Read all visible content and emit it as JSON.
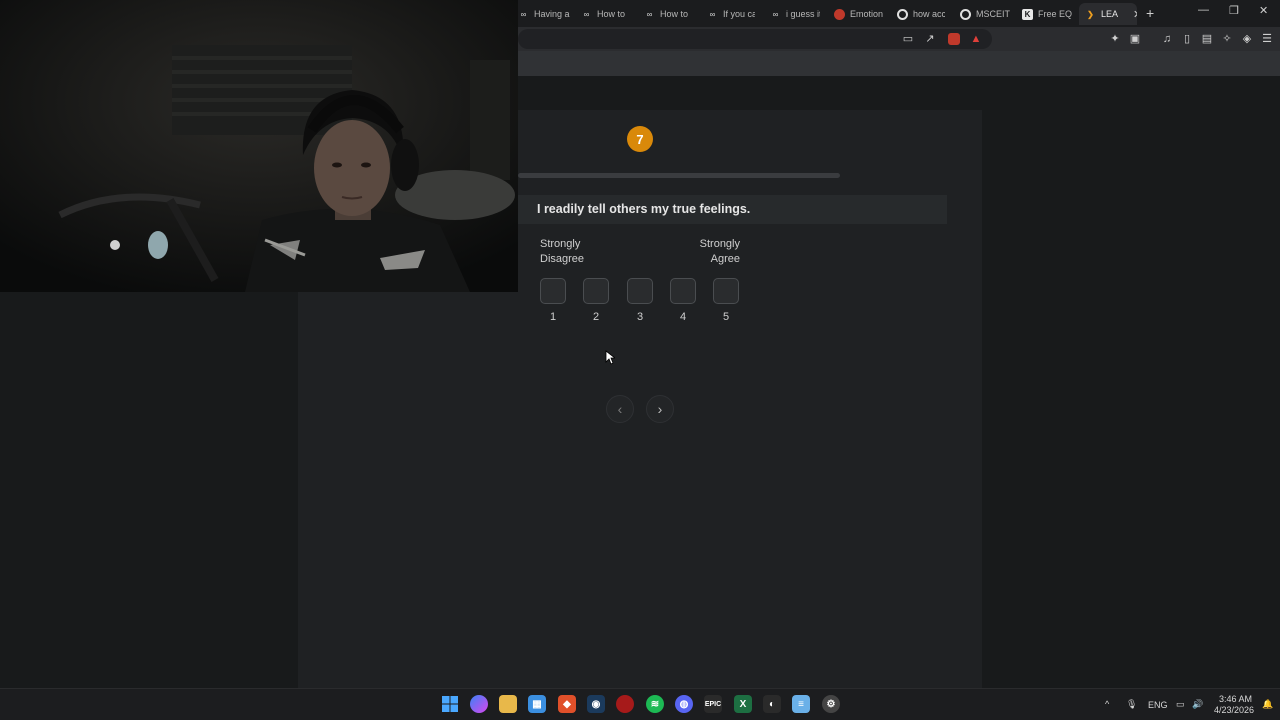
{
  "browser": {
    "tabs": [
      {
        "label": "Having a",
        "icon": "infinity-icon"
      },
      {
        "label": "How to",
        "icon": "infinity-icon"
      },
      {
        "label": "How to",
        "icon": "infinity-icon"
      },
      {
        "label": "If you ca",
        "icon": "infinity-icon"
      },
      {
        "label": "i guess it",
        "icon": "infinity-icon"
      },
      {
        "label": "Emotion",
        "icon": "drop-icon"
      },
      {
        "label": "how acc",
        "icon": "google-icon"
      },
      {
        "label": "MSCEIT",
        "icon": "google-icon"
      },
      {
        "label": "Free EQ",
        "icon": "k-logo-icon"
      },
      {
        "label": "LEA",
        "icon": "chevron-logo-icon",
        "active": true
      }
    ]
  },
  "quiz": {
    "question_number": "7",
    "progress": 0.0,
    "question": "I readily tell others my true feelings.",
    "scale_low": [
      "Strongly",
      "Disagree"
    ],
    "scale_high": [
      "Strongly",
      "Agree"
    ],
    "choices": [
      "1",
      "2",
      "3",
      "4",
      "5"
    ],
    "prev_symbol": "‹",
    "next_symbol": "›"
  },
  "taskbar": {
    "language": "ENG",
    "time": "3:46 AM",
    "date": "4/23/2026"
  },
  "colors": {
    "accent": "#d9890a",
    "page_bg": "#181a1b",
    "panel_bg": "#1f2123"
  }
}
